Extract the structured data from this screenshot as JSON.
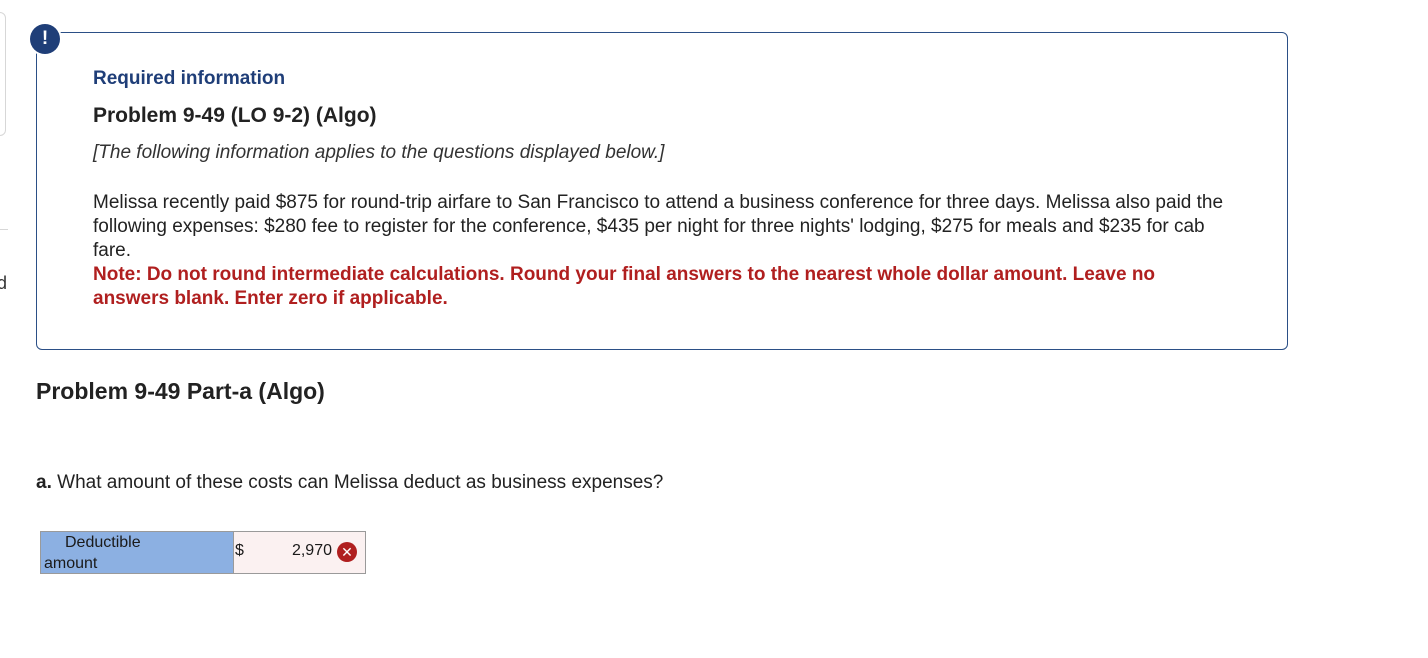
{
  "sidebar_edge": {
    "letter": "d"
  },
  "alert": {
    "icon": "!",
    "color": "#1f3e78"
  },
  "info_box": {
    "heading": "Required information",
    "problem_title": "Problem 9-49 (LO 9-2) (Algo)",
    "applies_text": "[The following information applies to the questions displayed below.]",
    "scenario": "Melissa recently paid $875 for round-trip airfare to San Francisco to attend a business conference for three days. Melissa also paid the following expenses: $280 fee to register for the conference, $435 per night for three nights' lodging, $275 for meals and $235 for cab fare.",
    "note": "Note: Do not round intermediate calculations. Round your final answers to the nearest whole dollar amount. Leave no answers blank. Enter zero if applicable."
  },
  "part": {
    "title": "Problem 9-49 Part-a (Algo)"
  },
  "question": {
    "prefix": "a.",
    "text": "What amount of these costs can Melissa deduct as business expenses?"
  },
  "answer_table": {
    "label_line1": "Deductible",
    "label_line2": "amount",
    "currency": "$",
    "value": "2,970",
    "status_icon": "incorrect-x",
    "status_symbol": "✕",
    "status_color": "#b01f1f",
    "label_bg": "#8cb0e2"
  }
}
